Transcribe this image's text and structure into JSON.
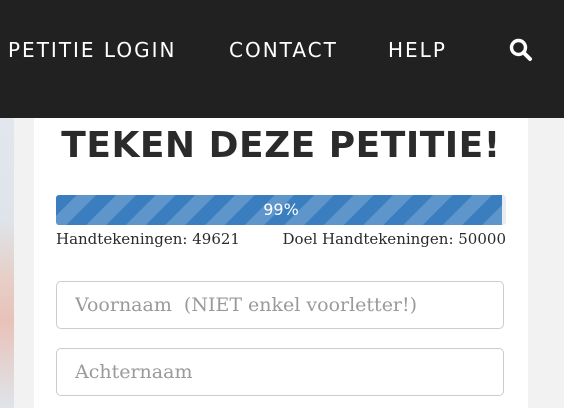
{
  "nav": {
    "items": [
      {
        "label": "PETITIE LOGIN"
      },
      {
        "label": "CONTACT"
      },
      {
        "label": "HELP"
      }
    ],
    "search_icon": "search-icon"
  },
  "petition": {
    "title": "TEKEN DEZE PETITIE!",
    "progress": {
      "percent": 99,
      "label": "99%",
      "color": "#3a7ec0"
    },
    "signatures_label": "Handtekeningen: 49621",
    "goal_label": "Doel Handtekeningen: 50000",
    "signatures": 49621,
    "goal": 50000
  },
  "form": {
    "first_name_placeholder": "Voornaam  (NIET enkel voorletter!)",
    "last_name_placeholder": "Achternaam"
  },
  "colors": {
    "nav_background": "#212121",
    "page_background": "#f2f2f2",
    "title_text": "#2b2b2b"
  }
}
